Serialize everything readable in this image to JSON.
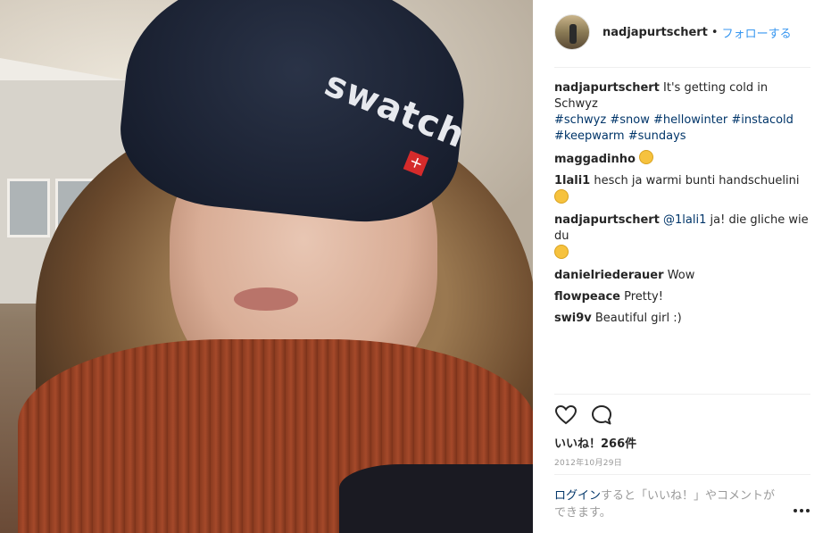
{
  "photo": {
    "brand_text": "swatch"
  },
  "header": {
    "username": "nadjapurtschert",
    "separator": "•",
    "follow_label": "フォローする"
  },
  "caption": {
    "username": "nadjapurtschert",
    "text": "It's getting cold in Schwyz",
    "hashtags": [
      "#schwyz",
      "#snow",
      "#hellowinter",
      "#instacold",
      "#keepwarm",
      "#sundays"
    ]
  },
  "comments": [
    {
      "username": "maggadinho",
      "text": "",
      "emoji": "ok-hand"
    },
    {
      "username": "1lali1",
      "text": "hesch ja warmi bunti handschuelini",
      "emoji": "wink"
    },
    {
      "username": "nadjapurtschert",
      "mention": "@1lali1",
      "text": "ja! die gliche wie du",
      "emoji": "wink"
    },
    {
      "username": "danielriederauer",
      "text": "Wow"
    },
    {
      "username": "flowpeace",
      "text": "Pretty!"
    },
    {
      "username": "swi9v",
      "text": "Beautiful girl :)"
    }
  ],
  "actions": {
    "like_icon": "heart-icon",
    "comment_icon": "comment-icon"
  },
  "likes_label": "いいね！266件",
  "date_label": "2012年10月29日",
  "login_prompt": {
    "link_text": "ログイン",
    "rest_text": "すると「いいね！」やコメントができます。"
  },
  "colors": {
    "link": "#003569",
    "follow": "#3897f0",
    "text": "#262626",
    "muted": "#999999"
  }
}
